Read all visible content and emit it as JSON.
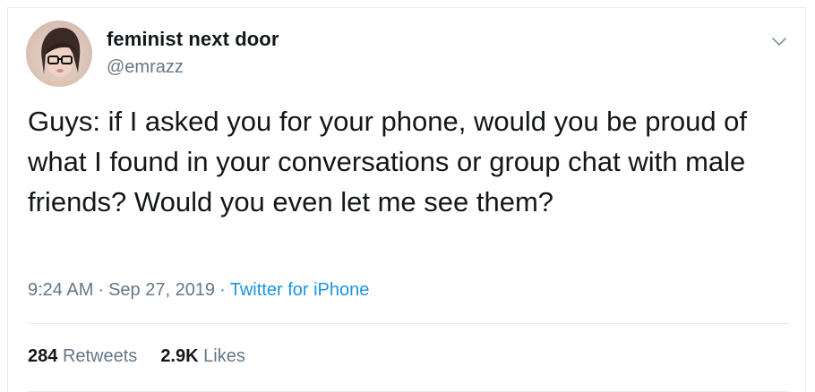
{
  "author": {
    "display_name": "feminist next door",
    "handle": "@emrazz"
  },
  "tweet": {
    "text": "Guys: if I asked you for your phone, would you be proud of what I found in your conversations or group chat with male friends? Would you even let me see them?",
    "time": "9:24 AM",
    "date": "Sep 27, 2019",
    "source": "Twitter for iPhone",
    "separator": "·"
  },
  "stats": {
    "retweets_count": "284",
    "retweets_label": "Retweets",
    "likes_count": "2.9K",
    "likes_label": "Likes"
  },
  "icons": {
    "menu": "chevron-down-icon",
    "avatar": "avatar"
  },
  "colors": {
    "link": "#1b95e0",
    "secondary_text": "#657786",
    "primary_text": "#14171a",
    "divider": "#e6ecf0"
  }
}
